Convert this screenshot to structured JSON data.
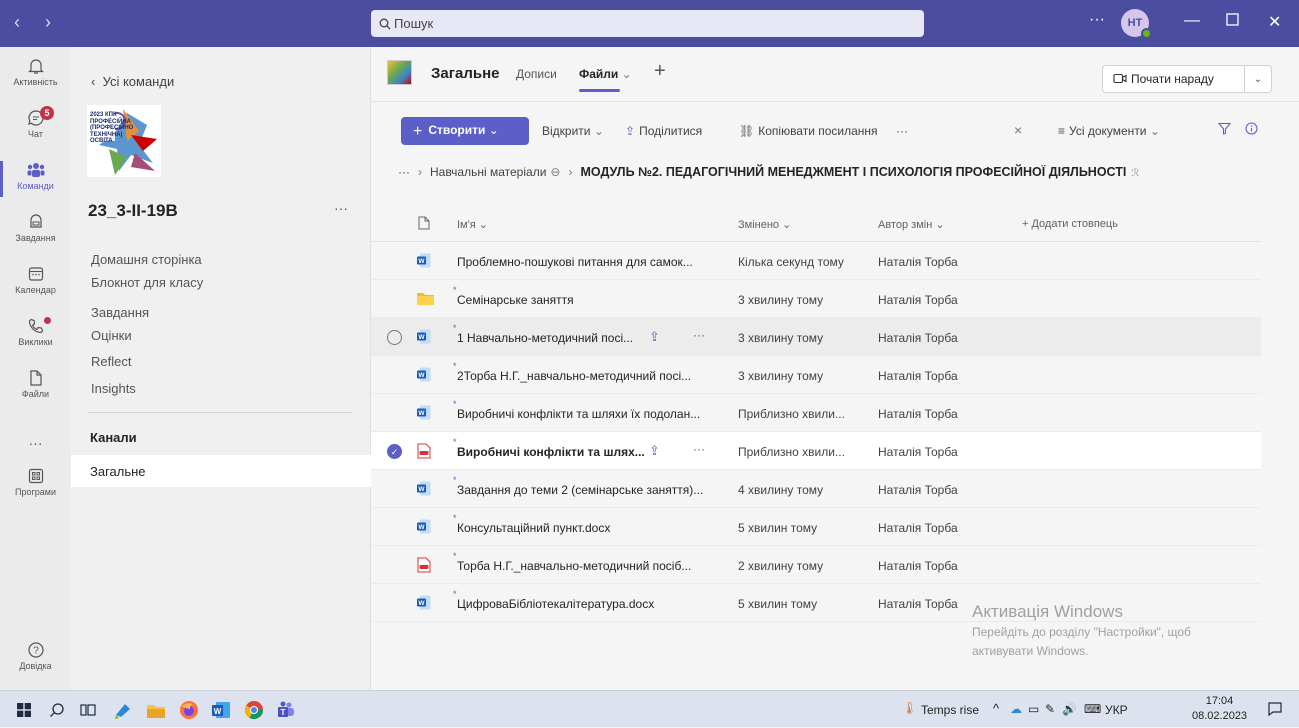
{
  "titlebar": {
    "search_placeholder": "Пошук",
    "more": "···",
    "avatar_initials": "НТ"
  },
  "rail": {
    "items": [
      {
        "label": "Активність",
        "icon": "bell-icon"
      },
      {
        "label": "Чат",
        "icon": "chat-icon",
        "badge": "5"
      },
      {
        "label": "Команди",
        "icon": "teams-icon",
        "active": true
      },
      {
        "label": "Завдання",
        "icon": "assignments-icon"
      },
      {
        "label": "Календар",
        "icon": "calendar-icon"
      },
      {
        "label": "Виклики",
        "icon": "phone-icon"
      },
      {
        "label": "Файли",
        "icon": "file-icon"
      },
      {
        "label": "···",
        "icon": "more-icon"
      },
      {
        "label": "Програми",
        "icon": "apps-icon"
      }
    ],
    "help_label": "Довідка"
  },
  "teampanel": {
    "back_label": "Усі команди",
    "team_name": "23_3-ІІ-19В",
    "team_more": "···",
    "logo_text": "2023 КПК ПРОФЕСІЙНА (ПРОФЕСІЙНО ТЕХНІЧНА) ОСВІТА",
    "links": [
      "Домашня сторінка",
      "Блокнот для класу",
      "Завдання",
      "Оцінки",
      "Reflect",
      "Insights"
    ],
    "channels_heading": "Канали",
    "channel": "Загальне"
  },
  "channel": {
    "title": "Загальне",
    "tabs": [
      "Дописи",
      "Файли"
    ],
    "active_tab": "Файли",
    "meet_button": "Почати нараду"
  },
  "toolbar": {
    "create": "Створити",
    "open": "Відкрити",
    "share": "Поділитися",
    "copy_link": "Копіювати посилання",
    "more": "···",
    "close": "×",
    "view": "Усі документи"
  },
  "breadcrumb": {
    "ellipsis": "···",
    "parent": "Навчальні матеріали",
    "current": "МОДУЛЬ №2. ПЕДАГОГІЧНИЙ МЕНЕДЖМЕНТ І ПСИХОЛОГІЯ ПРОФЕСІЙНОЇ ДІЯЛЬНОСТІ"
  },
  "table": {
    "headers": {
      "name": "Ім'я",
      "modified": "Змінено",
      "author": "Автор змін",
      "add_column": "+ Додати стовпець"
    },
    "rows": [
      {
        "type": "word",
        "name": "Проблемно-пошукові питання для самок...",
        "modified": "Кілька секунд тому",
        "author": "Наталія Торба",
        "new": false
      },
      {
        "type": "folder",
        "name": "Семінарське заняття",
        "modified": "3 хвилину тому",
        "author": "Наталія Торба",
        "new": true
      },
      {
        "type": "word",
        "name": "1 Навчально-методичний посі...",
        "modified": "3 хвилину тому",
        "author": "Наталія Торба",
        "new": true,
        "state": "hover"
      },
      {
        "type": "word",
        "name": "2Торба Н.Г._навчально-методичний посі...",
        "modified": "3 хвилину тому",
        "author": "Наталія Торба",
        "new": true
      },
      {
        "type": "word",
        "name": "Виробничі конфлікти та шляхи їх подолан...",
        "modified": "Приблизно хвили...",
        "author": "Наталія Торба",
        "new": true
      },
      {
        "type": "pdf",
        "name": "Виробничі конфлікти та шлях...",
        "modified": "Приблизно хвили...",
        "author": "Наталія Торба",
        "new": true,
        "state": "selected"
      },
      {
        "type": "word",
        "name": "Завдання до теми 2 (семінарське заняття)...",
        "modified": "4 хвилину тому",
        "author": "Наталія Торба",
        "new": true
      },
      {
        "type": "word",
        "name": "Консультаційний пункт.docx",
        "modified": "5 хвилин тому",
        "author": "Наталія Торба",
        "new": true
      },
      {
        "type": "pdf",
        "name": "Торба Н.Г._навчально-методичний посіб...",
        "modified": "2 хвилину тому",
        "author": "Наталія Торба",
        "new": true
      },
      {
        "type": "word",
        "name": "ЦифроваБібліотекалітература.docx",
        "modified": "5 хвилин тому",
        "author": "Наталія Торба",
        "new": true
      }
    ]
  },
  "watermark": {
    "line1": "Активація Windows",
    "line2": "Перейдіть до розділу \"Настройки\", щоб",
    "line3": "активувати Windows."
  },
  "taskbar": {
    "weather": "Temps rise",
    "lang": "УКР",
    "time": "17:04",
    "date": "08.02.2023"
  },
  "colors": {
    "accent": "#5b5fc7",
    "titlebar": "#4b4ea0",
    "badge": "#c4314b"
  }
}
